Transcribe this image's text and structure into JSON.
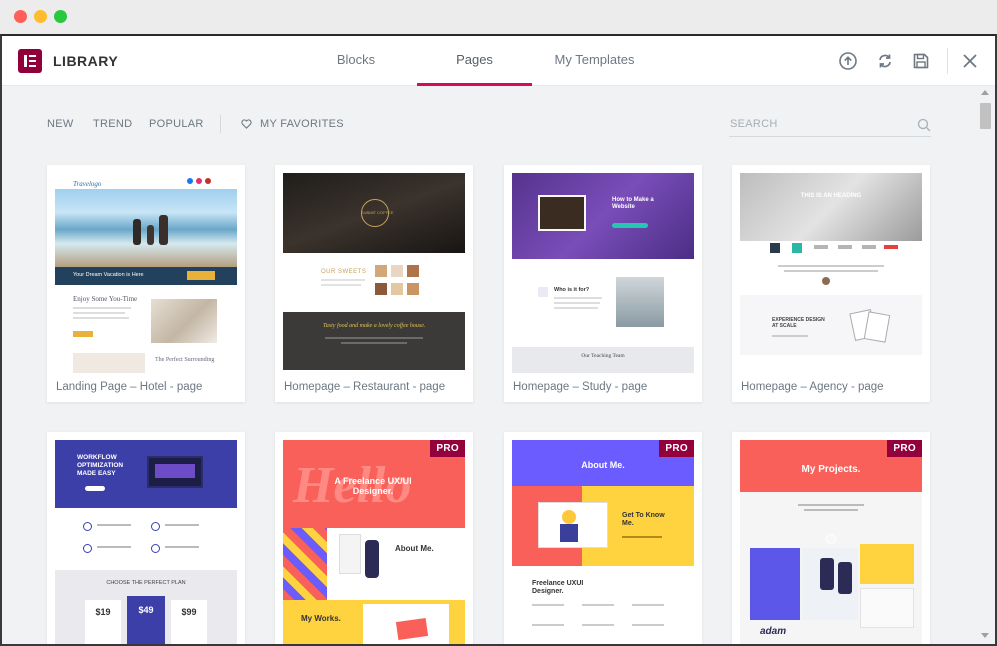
{
  "header": {
    "library_title": "LIBRARY",
    "tabs": [
      {
        "label": "Blocks"
      },
      {
        "label": "Pages"
      },
      {
        "label": "My Templates"
      }
    ],
    "active_tab": "Pages",
    "icons": [
      "upload-icon",
      "sync-icon",
      "save-icon",
      "close-icon"
    ],
    "accent_color": "#d30c5c",
    "brand_color": "#92003b"
  },
  "filters": {
    "items": [
      {
        "label": "NEW"
      },
      {
        "label": "TREND"
      },
      {
        "label": "POPULAR"
      }
    ],
    "favorites_label": "MY FAVORITES",
    "search_placeholder": "SEARCH"
  },
  "templates": [
    {
      "title": "Landing Page – Hotel - page",
      "pro": false,
      "thumb": {
        "banner": "Your Dream Vacation is Here",
        "heading": "Enjoy Some You-Time",
        "caption": "The Perfect Surrounding",
        "logo": "Travelogo"
      }
    },
    {
      "title": "Homepage – Restaurant - page",
      "pro": false,
      "thumb": {
        "badge": "SUBMIT COFFEE",
        "heading": "OUR SWEETS",
        "quote": "Tasty food and make a lovely coffee house."
      }
    },
    {
      "title": "Homepage – Study - page",
      "pro": false,
      "thumb": {
        "heading": "How to Make a Website",
        "sub": "Who is it for?",
        "footer": "Our Teaching Team"
      }
    },
    {
      "title": "Homepage – Agency - page",
      "pro": false,
      "thumb": {
        "heading": "THIS IS AN HEADING",
        "sub": "EXPERIENCE DESIGN AT SCALE"
      }
    },
    {
      "title": "",
      "pro": false,
      "thumb": {
        "heading": "WORKFLOW OPTIMIZATION MADE EASY",
        "plan": "CHOOSE THE PERFECT PLAN",
        "prices": [
          "$19",
          "$49",
          "$99"
        ]
      }
    },
    {
      "title": "",
      "pro": true,
      "thumb": {
        "big": "Hello",
        "heading": "A Freelance UX/UI Designer.",
        "about": "About Me.",
        "works": "My Works."
      }
    },
    {
      "title": "",
      "pro": true,
      "thumb": {
        "heading": "About Me.",
        "sub": "Get To Know Me.",
        "lower": "Freelance UXUI Designer."
      }
    },
    {
      "title": "",
      "pro": true,
      "thumb": {
        "heading": "My Projects.",
        "adam": "adam"
      }
    }
  ],
  "pro_label": "PRO"
}
